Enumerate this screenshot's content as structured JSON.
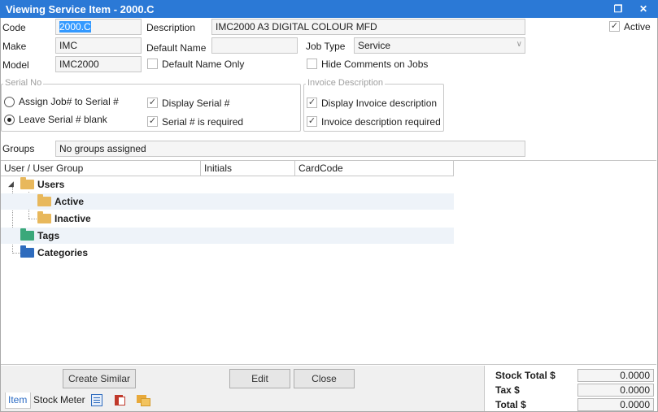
{
  "window": {
    "title": "Viewing Service Item - 2000.C"
  },
  "form": {
    "code_label": "Code",
    "code_value": "2000.C",
    "description_label": "Description",
    "description_value": "IMC2000 A3 DIGITAL COLOUR MFD",
    "active_label": "Active",
    "active_checked": true,
    "make_label": "Make",
    "make_value": "IMC",
    "default_name_label": "Default Name",
    "default_name_value": "",
    "job_type_label": "Job Type",
    "job_type_value": "Service",
    "model_label": "Model",
    "model_value": "IMC2000",
    "default_name_only_label": "Default Name Only",
    "default_name_only_checked": false,
    "hide_comments_label": "Hide Comments on Jobs",
    "hide_comments_checked": false
  },
  "serial_group": {
    "title": "Serial No",
    "assign_label": "Assign Job# to Serial #",
    "leave_label": "Leave Serial # blank",
    "selected": "leave",
    "display_serial_label": "Display Serial #",
    "serial_required_label": "Serial # is required"
  },
  "invoice_group": {
    "title": "Invoice Description",
    "display_label": "Display Invoice description",
    "required_label": "Invoice description required"
  },
  "groups": {
    "label": "Groups",
    "value": "No groups assigned"
  },
  "grid": {
    "columns": [
      "User / User Group",
      "Initials",
      "CardCode"
    ],
    "rows": [
      {
        "label": "Users",
        "color": "#e8b85c"
      },
      {
        "label": "Active",
        "color": "#e8b85c"
      },
      {
        "label": "Inactive",
        "color": "#e8b85c"
      },
      {
        "label": "Tags",
        "color": "#3aa87a"
      },
      {
        "label": "Categories",
        "color": "#2e6bbd"
      }
    ]
  },
  "buttons": {
    "create_similar": "Create Similar",
    "edit": "Edit",
    "close": "Close"
  },
  "tabs": [
    "Item",
    "Stock",
    "Meter"
  ],
  "totals": {
    "stock_label": "Stock Total $",
    "stock_value": "0.0000",
    "tax_label": "Tax $",
    "tax_value": "0.0000",
    "total_label": "Total $",
    "total_value": "0.0000"
  }
}
